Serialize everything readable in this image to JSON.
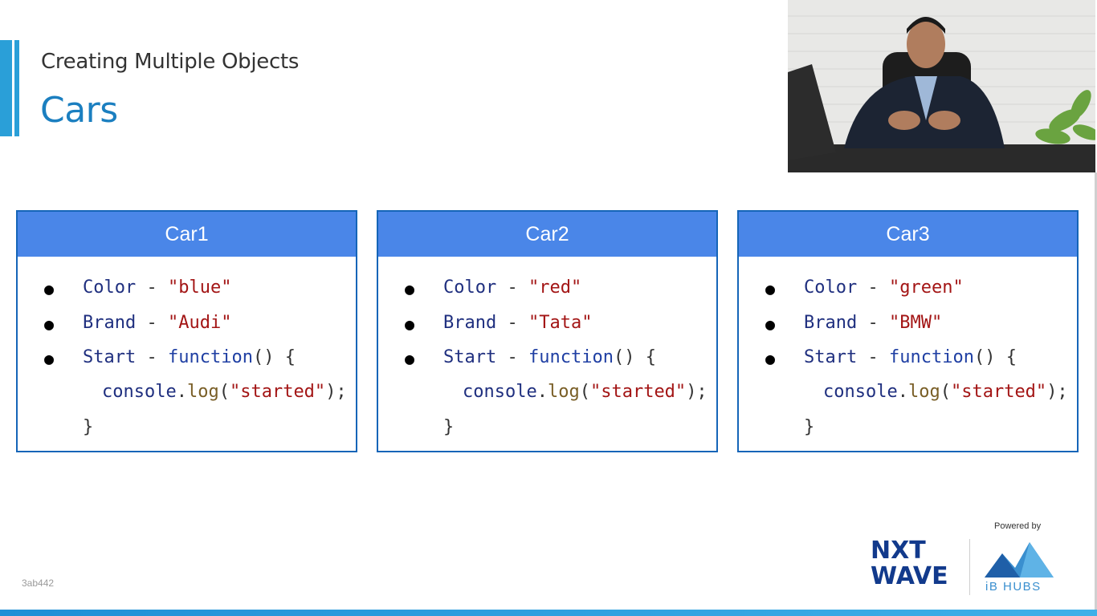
{
  "slide": {
    "subtitle": "Creating Multiple Objects",
    "title": "Cars",
    "watermark": "3ab442"
  },
  "colors": {
    "accent": "#2a9fd8",
    "title": "#1b7fc0",
    "card_header": "#4a86e8",
    "card_border": "#1565b8",
    "string": "#a31515",
    "keyword": "#1f2f7f"
  },
  "cards": [
    {
      "name": "Car1",
      "color_key": "Color",
      "color_val": "\"blue\"",
      "brand_key": "Brand",
      "brand_val": "\"Audi\"",
      "start_key": "Start",
      "fn": "function",
      "console": "console",
      "log": "log",
      "started": "\"started\""
    },
    {
      "name": "Car2",
      "color_key": "Color",
      "color_val": "\"red\"",
      "brand_key": "Brand",
      "brand_val": "\"Tata\"",
      "start_key": "Start",
      "fn": "function",
      "console": "console",
      "log": "log",
      "started": "\"started\""
    },
    {
      "name": "Car3",
      "color_key": "Color",
      "color_val": "\"green\"",
      "brand_key": "Brand",
      "brand_val": "\"BMW\"",
      "start_key": "Start",
      "fn": "function",
      "console": "console",
      "log": "log",
      "started": "\"started\""
    }
  ],
  "logos": {
    "nxt": "NXT",
    "wave": "WAVE",
    "powered_by": "Powered by",
    "ib_hubs": "iB HUBS"
  },
  "icons": {
    "video": "presenter-video",
    "ib_mark": "mountain-logo-icon"
  }
}
